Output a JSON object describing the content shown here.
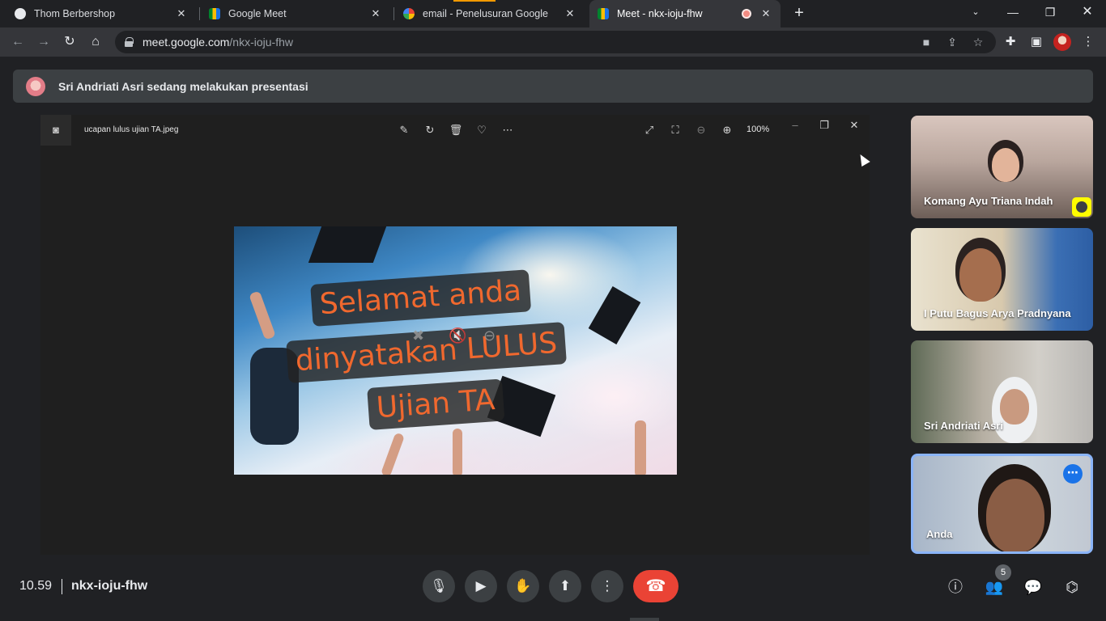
{
  "browser": {
    "tabs": [
      {
        "title": "Thom Berbershop",
        "favicon": "github-icon"
      },
      {
        "title": "Google Meet",
        "favicon": "meet-icon"
      },
      {
        "title": "email - Penelusuran Google",
        "favicon": "google-icon"
      },
      {
        "title": "Meet - nkx-ioju-fhw",
        "favicon": "meet-icon",
        "active": true,
        "recording": true
      }
    ],
    "url_host": "meet.google.com",
    "url_path": "/nkx-ioju-fhw"
  },
  "banner": {
    "text": "Sri Andriati Asri sedang melakukan presentasi"
  },
  "viewer": {
    "filename": "ucapan lulus ujian TA.jpeg",
    "zoom": "100%",
    "image_caption": [
      "Selamat anda",
      "dinyatakan LULUS",
      "Ujian TA"
    ]
  },
  "participants": [
    {
      "name": "Komang Ayu Triana Indah"
    },
    {
      "name": "I Putu Bagus Arya Pradnyana"
    },
    {
      "name": "Sri Andriati Asri"
    },
    {
      "name": "Anda",
      "self": true
    }
  ],
  "meeting": {
    "time": "10.59",
    "code": "nkx-ioju-fhw",
    "participant_count": "5"
  },
  "colors": {
    "background": "#202124",
    "hangup": "#ea4335",
    "accent": "#1a73e8",
    "caption_text": "#f0682e"
  }
}
